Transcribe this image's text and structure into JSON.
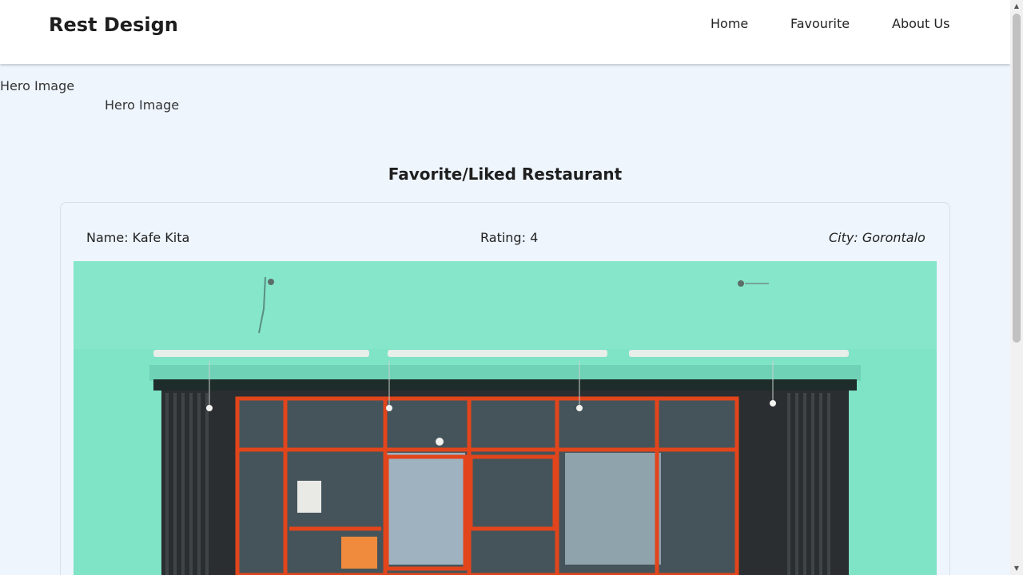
{
  "header": {
    "brand": "Rest Design",
    "nav": [
      {
        "label": "Home"
      },
      {
        "label": "Favourite"
      },
      {
        "label": "About Us"
      }
    ]
  },
  "hero": {
    "alt_primary": "Hero Image",
    "alt_secondary": "Hero Image"
  },
  "main": {
    "title": "Favorite/Liked Restaurant",
    "restaurant": {
      "name": "Name: Kafe Kita",
      "rating": "Rating: 4",
      "city": "City: Gorontalo"
    }
  },
  "colors": {
    "page_bg": "#eef5fd",
    "wall": "#7fe3c6",
    "frame": "#e2451b"
  },
  "icons": {
    "scroll_up": "triangle-up",
    "scroll_down": "triangle-down"
  }
}
